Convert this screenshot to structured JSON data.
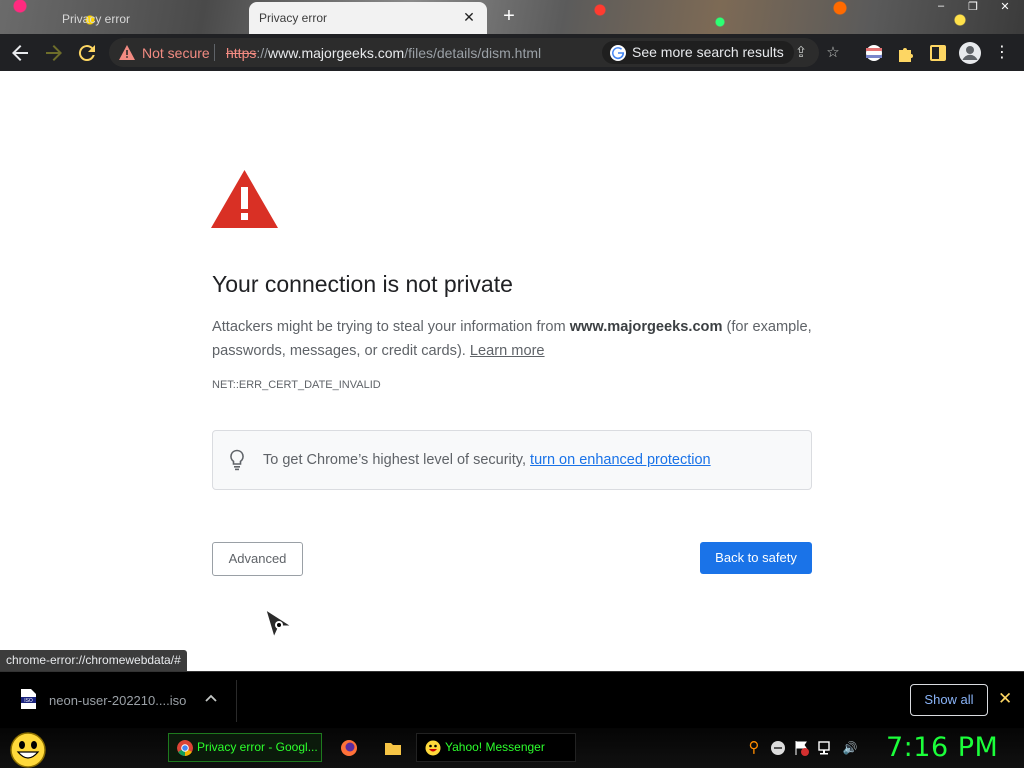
{
  "browser": {
    "tabs": [
      {
        "label": "Privacy error",
        "active": false
      },
      {
        "label": "Privacy error",
        "active": true
      }
    ],
    "new_tab_symbol": "+",
    "close_symbol": "✕",
    "window_controls": [
      "–",
      "❐",
      "✕"
    ]
  },
  "toolbar": {
    "security_label": "Not secure",
    "url_scheme": "https",
    "url_sep": "://",
    "url_host": "www.majorgeeks.com",
    "url_path": "/files/details/dism.html",
    "search_chip": "See more search results"
  },
  "page": {
    "heading": "Your connection is not private",
    "desc_before": "Attackers might be trying to steal your information from ",
    "desc_host": "www.majorgeeks.com",
    "desc_after": " (for example, passwords, messages, or credit cards). ",
    "learn_more": "Learn more",
    "error_code": "NET::ERR_CERT_DATE_INVALID",
    "security_text": "To get Chrome’s highest level of security, ",
    "security_link": "turn on enhanced protection",
    "advanced_button": "Advanced",
    "back_button": "Back to safety",
    "status_url": "chrome-error://chromewebdata/#"
  },
  "downloads": {
    "file_name": "neon-user-202210....iso",
    "file_badge": "ISO",
    "show_all": "Show all"
  },
  "taskbar": {
    "tasks": [
      {
        "label": "Privacy error - Googl..."
      },
      {
        "label": "Yahoo! Messenger"
      }
    ],
    "clock": "7:16 PM"
  },
  "colors": {
    "danger_red": "#d93025",
    "chrome_blue": "#1a73e8",
    "clock_green": "#1bff3a",
    "toolbar_bg": "#202124"
  }
}
